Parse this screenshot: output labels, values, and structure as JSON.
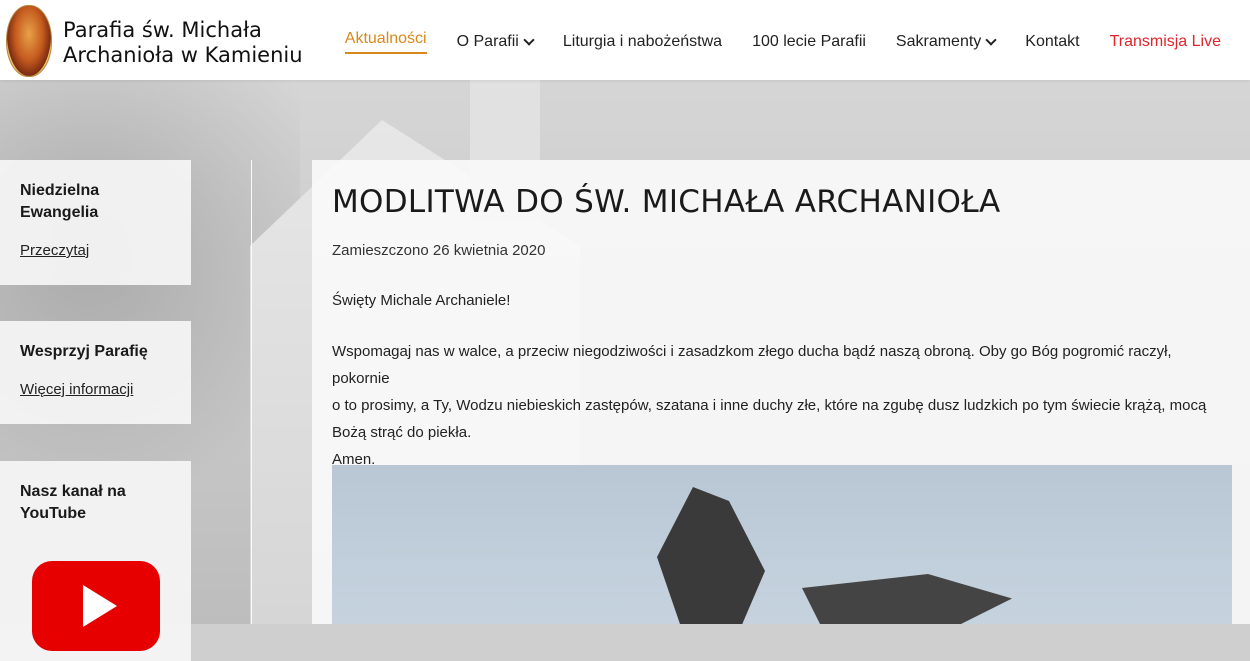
{
  "site": {
    "title_line1": "Parafia św. Michała",
    "title_line2": "Archanioła w Kamieniu"
  },
  "nav": {
    "items": [
      {
        "label": "Aktualności",
        "active": true
      },
      {
        "label": "O Parafii",
        "dropdown": true
      },
      {
        "label": "Liturgia i nabożeństwa"
      },
      {
        "label": "100 lecie Parafii"
      },
      {
        "label": "Sakramenty",
        "dropdown": true
      },
      {
        "label": "Kontakt"
      },
      {
        "label": "Transmisja Live",
        "color": "#e0242c"
      }
    ]
  },
  "sidebar": {
    "widgets": [
      {
        "title": "Niedzielna Ewangelia",
        "link": "Przeczytaj"
      },
      {
        "title": "Wesprzyj Parafię",
        "link": "Więcej informacji"
      },
      {
        "title": "Nasz kanał na YouTube",
        "icon": "youtube-icon"
      }
    ]
  },
  "post": {
    "title": "MODLITWA DO ŚW. MICHAŁA ARCHANIOŁA",
    "meta": "Zamieszczono 26 kwietnia 2020",
    "greeting": "Święty Michale Archaniele!",
    "body_line1": "Wspomagaj nas w walce, a przeciw niegodziwości i zasadzkom złego ducha bądź naszą obroną. Oby go Bóg pogromić raczył, pokornie",
    "body_line2": "o to prosimy, a Ty, Wodzu niebieskich zastępów, szatana i inne duchy złe, które na zgubę dusz ludzkich po tym świecie krążą, mocą",
    "body_line3": "Bożą strąć do piekła.",
    "amen": "Amen."
  },
  "colors": {
    "accent": "#d9891b",
    "live": "#e0242c",
    "youtube": "#e60000"
  }
}
